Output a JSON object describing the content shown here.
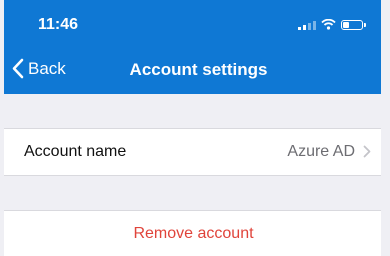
{
  "status_bar": {
    "time": "11:46",
    "icons": [
      "signal-icon",
      "wifi-icon",
      "battery-icon"
    ]
  },
  "nav_bar": {
    "back_label": "Back",
    "title": "Account settings"
  },
  "account_row": {
    "label": "Account name",
    "value": "Azure AD",
    "icon": "chevron-right-icon"
  },
  "remove_row": {
    "label": "Remove account"
  },
  "colors": {
    "header": "#0f78d4",
    "destructive": "#e0443b",
    "background": "#efeff4"
  }
}
